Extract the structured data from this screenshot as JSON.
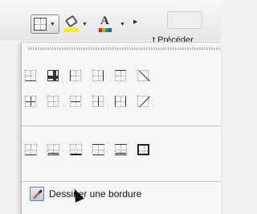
{
  "toolbar": {
    "borders_button": {
      "icon": "borders-icon"
    },
    "fill_button": {
      "icon": "fill-color-icon",
      "color": "#f4ea1c"
    },
    "font_color_button": {
      "icon": "font-color-icon",
      "letter": "A"
    },
    "truncated_label": "t  Précéder"
  },
  "menu": {
    "border_options_row1": [
      "bottom-border-icon",
      "all-borders-icon",
      "left-border-icon",
      "right-border-icon",
      "top-border-icon",
      "diagonal-down-icon"
    ],
    "border_options_row2": [
      "inside-borders-icon",
      "outside-left-icon",
      "inside-horizontal-icon",
      "inside-vertical-icon",
      "thick-bottom-icon",
      "diagonal-up-icon"
    ],
    "border_options_row3": [
      "bottom-line-icon",
      "double-bottom-icon",
      "thick-bottom-border-icon",
      "top-bottom-icon",
      "top-double-bottom-icon",
      "thick-outside-icon"
    ],
    "draw_border_label": "Dessiner une bordure"
  }
}
